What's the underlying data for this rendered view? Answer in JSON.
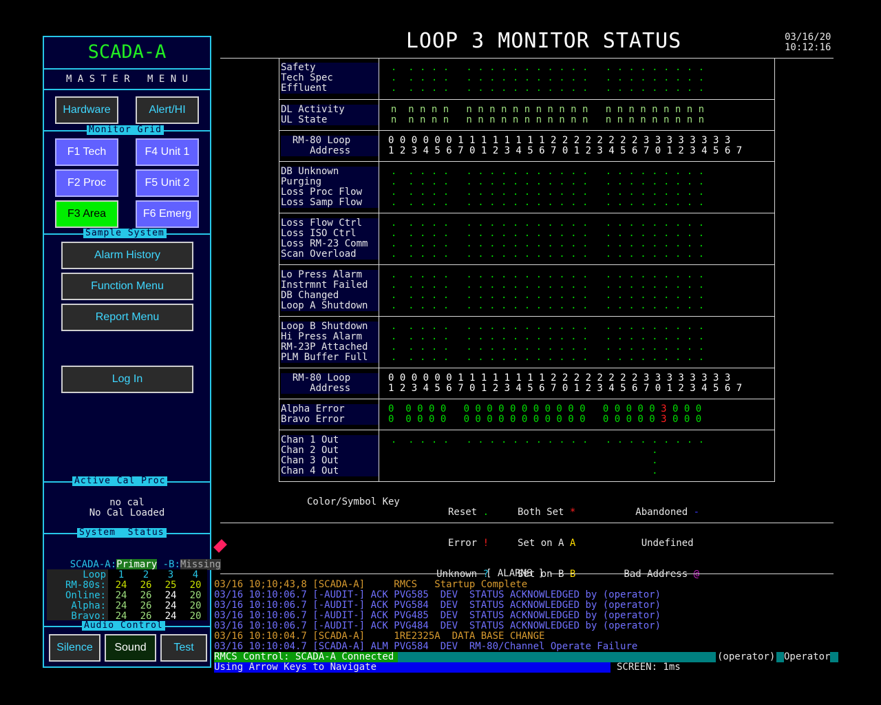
{
  "header": {
    "title": "LOOP 3 MONITOR STATUS",
    "date": "03/16/20",
    "time": "10:12:16"
  },
  "sidebar": {
    "title": "SCADA-A",
    "menu": "M A S T E R   M E N U",
    "hardware": "Hardware",
    "alert": "Alert/HI",
    "monitor_grid": "Monitor Grid",
    "f1": "F1 Tech",
    "f4": "F4 Unit 1",
    "f2": "F2 Proc",
    "f5": "F5 Unit 2",
    "f3": "F3 Area",
    "f6": "F6 Emerg",
    "sample_system": "Sample System",
    "alarm_history": "Alarm History",
    "function_menu": "Function Menu",
    "report_menu": "Report Menu",
    "log_in": "Log In",
    "active_cal": "Active Cal Proc",
    "no_cal": "no cal",
    "no_cal_loaded": "No Cal Loaded",
    "system_status": "System  Status",
    "scada_a": "SCADA-A:",
    "primary": "Primary",
    "b_label": " -B:",
    "missing": "Missing",
    "table_rows": [
      {
        "label": "Loop",
        "v": [
          "1",
          "2",
          "3",
          "4"
        ]
      },
      {
        "label": "RM-80s:",
        "v": [
          "24",
          "26",
          "25",
          "20"
        ]
      },
      {
        "label": "Online:",
        "v": [
          "24",
          "26",
          "24",
          "20"
        ]
      },
      {
        "label": "Alpha:",
        "v": [
          "24",
          "26",
          "24",
          "20"
        ]
      },
      {
        "label": "Bravo:",
        "v": [
          "24",
          "26",
          "24",
          "20"
        ]
      }
    ],
    "audio_control": "Audio Control",
    "silence": "Silence",
    "sound": "Sound",
    "test": "Test"
  },
  "grid": {
    "g1": {
      "labels": "Safety\nTech Spec\nEffluent",
      "dots": "  .  . . . .   . . . . . . . . . . .   . . . . . . . . .\n  .  . . . .   . . . . . . . . . . .   . . . . . . . . .\n  .  . . . .   . . . . . . . . . . .   . . . . . . . . ."
    },
    "g2": {
      "labels": "DL Activity\nUL State",
      "dots": "  n  n n n n   n n n n n n n n n n n   n n n n n n n n n\n  n  n n n n   n n n n n n n n n n n   n n n n n n n n n"
    },
    "addr_label": "  RM-80 Loop\n     Address",
    "addr_row1": "0 0 0 0 0 0 1 1 1 1 1 1 1 1 2 2 2 2 2 2 2 2 3 3 3 3 3 3 3 3",
    "addr_row2": "1 2 3 4 5 6 7 0 1 2 3 4 5 6 7 0 1 2 3 4 5 6 7 0 1 2 3 4 5 6 7",
    "g3": {
      "labels": "DB Unknown\nPurging\nLoss Proc Flow\nLoss Samp Flow",
      "dots": "  .  . . . .   . . . . . . . . . . .   . . . . . . . . .\n  .  . . . .   . . . . . . . . . . .   . . . . . . . . .\n  .  . . . .   . . . . . . . . . . .   . . . . . . . . .\n  .  . . . .   . . . . . . . . . . .   . . . . . . . . ."
    },
    "g4": {
      "labels": "Loss Flow Ctrl\nLoss ISO Ctrl\nLoss RM-23 Comm\nScan Overload",
      "dots": "  .  . . . .   . . . . . . . . . . .   . . . . . . . . .\n  .  . . . .   . . . . . . . . . . .   . . . . . . . . .\n  .  . . . .   . . . . . . . . . . .   . . . . . . . . .\n  .  . . . .   . . . . . . . . . . .   . . . . . . . . ."
    },
    "g5": {
      "labels": "Lo Press Alarm\nInstrmnt Failed\nDB Changed\nLoop A Shutdown",
      "dots": "  .  . . . .   . . . . . . . . . . .   . . . . . . . . .\n  .  . . . .   . . . . . . . . . . .   . . . . . . . . .\n  .  . . . .   . . . . . . . . . . .   . . . . . . . . .\n  .  . . . .   . . . . . . . . . . .   . . . . . . . . ."
    },
    "g6": {
      "labels": "Loop B Shutdown\nHi Press Alarm\nRM-23P Attached\nPLM Buffer Full",
      "dots": "  .  . . . .   . . . . . . . . . . .   . . . . . . . . .\n  .  . . . .   . . . . . . . . . . .   . . . . . . . . .\n  .  . . . .   . . . . . . . . . . .   . . . . . . . . .\n  .  . . . .   . . . . . . . . . . .   . . . . . . . . ."
    },
    "g7": {
      "labels": "Alpha Error\nBravo Error",
      "row1a": "0  0 0 0 0   0 0 0 0 0 0 0 0 0 0 0   0 0 0 0 0 ",
      "row1red": "3",
      "row1b": " 0 0 0",
      "row2a": "0  0 0 0 0   0 0 0 0 0 0 0 0 0 0 0   0 0 0 0 0 ",
      "row2red": "3",
      "row2b": " 0 0 0"
    },
    "g8": {
      "labels": "Chan 1 Out\nChan 2 Out\nChan 3 Out\nChan 4 Out",
      "dots": "  .  . . . .   . . . . . . . . . . .   . . . . . . . . .\n                                               .\n                                               .\n                                               ."
    }
  },
  "key": {
    "title": "Color/Symbol Key",
    "reset": "Reset",
    "reset_sym": ".",
    "error": "Error",
    "error_sym": "!",
    "unknown": "Unknown",
    "unknown_sym": "?",
    "both": "Both Set",
    "both_sym": "*",
    "seta": "Set on A",
    "seta_sym": "A",
    "setb": "Set on B",
    "setb_sym": "B",
    "aband": "Abandoned",
    "aband_sym": "-",
    "undef": "Undefined",
    "undef_sym": "",
    "badaddr": "Bad Address",
    "badaddr_sym": "@"
  },
  "alarms": {
    "title": "[ ALARMS ]",
    "rows": [
      {
        "t": "03/16 10;10;43,8 [SCADA-A]     RMCS   Startup Complete",
        "c": "#d89b2f"
      },
      {
        "t": "03/16 10:10:06.7 [-AUDIT-] ACK PVG585  DEV  STATUS ACKNOWLEDGED by (operator)",
        "c": "#7070ff"
      },
      {
        "t": "03/16 10:10:06.7 [-AUDIT-] ACK PVG584  DEV  STATUS ACKNOWLEDGED by (operator)",
        "c": "#7070ff"
      },
      {
        "t": "03/16 10:10:06.7 [-AUDIT-] ACK PVG485  DEV  STATUS ACKNOWLEDGED by (operator)",
        "c": "#7070ff"
      },
      {
        "t": "03/16 10:10:06.7 [-AUDIT-] ACK PVG484  DEV  STATUS ACKNOWLEDGED by (operator)",
        "c": "#7070ff"
      },
      {
        "t": "03/16 10:10:04.7 [SCADA-A]     1RE2325A  DATA BASE CHANGE",
        "c": "#d89b2f"
      },
      {
        "t": "03/16 10:10:04.7 [SCADA-A] ALM PVG584  DEV  RM-80/Channel Operate Failure",
        "c": "#7070ff"
      }
    ]
  },
  "status": {
    "control": "RMCS Control: SCADA-A Connected",
    "user": "(operator)",
    "role": "Operator",
    "nav": "Using Arrow Keys to Navigate",
    "screen": "SCREEN: 1ms"
  }
}
